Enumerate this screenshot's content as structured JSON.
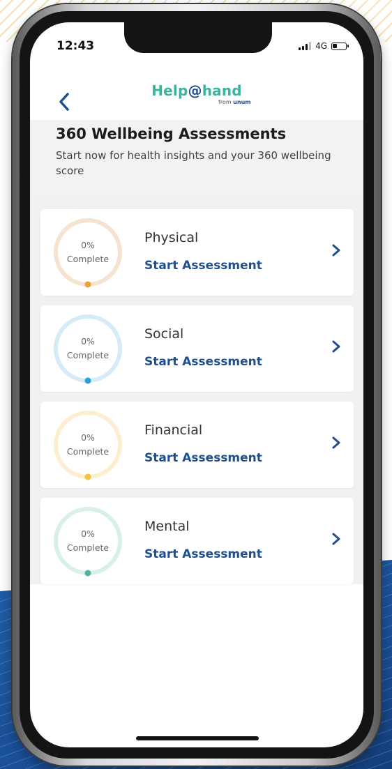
{
  "status_bar": {
    "time": "12:43",
    "network": "4G"
  },
  "header": {
    "logo_text_left": "Help",
    "logo_text_at": "@",
    "logo_text_right": "hand",
    "logo_sub_prefix": "from",
    "logo_sub_brand": "unum"
  },
  "intro": {
    "title": "360 Wellbeing Assessments",
    "subtitle": "Start now for health insights and your 360 wellbeing score"
  },
  "assessments": [
    {
      "name": "Physical",
      "percent": "0%",
      "status": "Complete",
      "action": "Start Assessment",
      "color": "#f4e3cf",
      "dot": "#e9a23c",
      "progress": 0
    },
    {
      "name": "Social",
      "percent": "0%",
      "status": "Complete",
      "action": "Start Assessment",
      "color": "#d5ebf6",
      "dot": "#2aa0d8",
      "progress": 0
    },
    {
      "name": "Financial",
      "percent": "0%",
      "status": "Complete",
      "action": "Start Assessment",
      "color": "#fbefcf",
      "dot": "#f2c23a",
      "progress": 0
    },
    {
      "name": "Mental",
      "percent": "0%",
      "status": "Complete",
      "action": "Start Assessment",
      "color": "#d9efea",
      "dot": "#4fb4a4",
      "progress": 0
    }
  ]
}
